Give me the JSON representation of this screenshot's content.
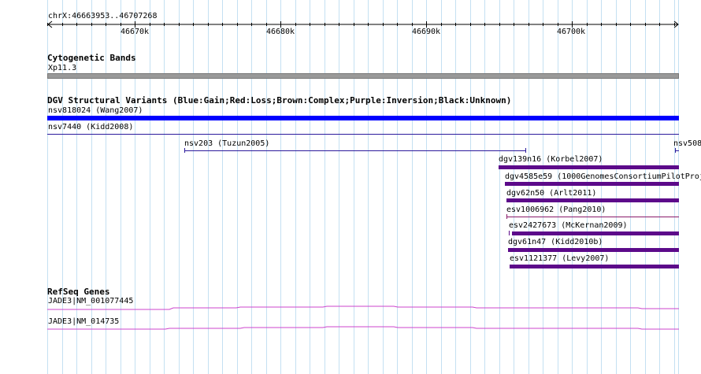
{
  "ruler": {
    "range_label": "chrX:46663953..46707268",
    "ticks": [
      "46670k",
      "46680k",
      "46690k",
      "46700k"
    ]
  },
  "tracks": {
    "cytoband": {
      "title": "Cytogenetic Bands",
      "band_label": "Xp11.3",
      "band_color": "#999999"
    },
    "dgv": {
      "title": "DGV Structural Variants (Blue:Gain;Red:Loss;Brown:Complex;Purple:Inversion;Black:Unknown)",
      "features": [
        {
          "label": "nsv818024 (Wang2007)",
          "color": "#0000ff",
          "style": "bar"
        },
        {
          "label": "nsv7440 (Kidd2008)",
          "color": "#2c1a9c",
          "style": "line"
        },
        {
          "label": "nsv203 (Tuzun2005)",
          "color": "#2c1a9c",
          "style": "line"
        },
        {
          "label": "nsv508",
          "color": "#2c1a9c",
          "style": "line"
        },
        {
          "label": "dgv139n16 (Korbel2007)",
          "color": "#5c0a8a",
          "style": "bar"
        },
        {
          "label": "dgv4585e59 (1000GenomesConsortiumPilotProj",
          "color": "#5c0a8a",
          "style": "bar"
        },
        {
          "label": "dgv62n50 (Arlt2011)",
          "color": "#5c0a8a",
          "style": "bar"
        },
        {
          "label": "esv1006962 (Pang2010)",
          "color": "#8a1a6a",
          "style": "line"
        },
        {
          "label": "esv2427673 (McKernan2009)",
          "color": "#5c0a8a",
          "style": "bar"
        },
        {
          "label": "dgv61n47 (Kidd2010b)",
          "color": "#5c0a8a",
          "style": "bar"
        },
        {
          "label": "esv1121377 (Levy2007)",
          "color": "#5c0a8a",
          "style": "bar"
        }
      ]
    },
    "refseq": {
      "title": "RefSeq Genes",
      "gene_color": "#cc44cc",
      "genes": [
        {
          "label": "JADE3|NM_001077445"
        },
        {
          "label": "JADE3|NM_014735"
        }
      ]
    }
  }
}
